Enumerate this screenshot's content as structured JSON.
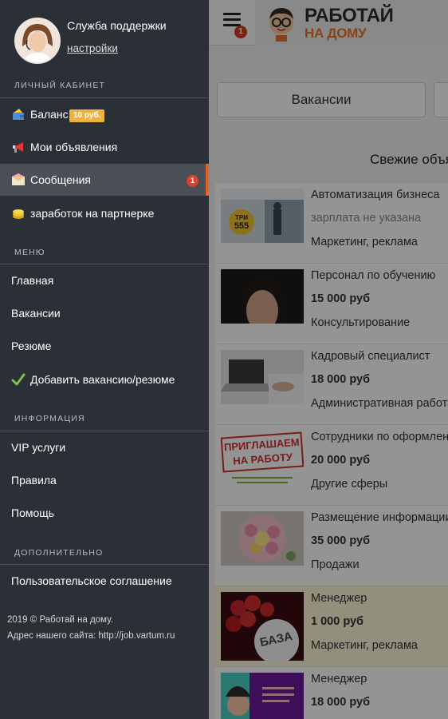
{
  "header": {
    "notification_count": "1",
    "logo_line1": "РАБОТАЙ",
    "logo_line2": "НА ДОМУ"
  },
  "tabs": [
    {
      "label": "Вакансии"
    }
  ],
  "section_title": "Свежие объя",
  "listings": [
    {
      "title": "Автоматизация бизнеса",
      "price": "зарплата не указана",
      "category": "Маркетинг, реклама",
      "thumb_text": [
        "ТРИ",
        "555"
      ],
      "highlight": false
    },
    {
      "title": "Персонал по обучению",
      "price": "15 000 руб",
      "category": "Консультирование",
      "highlight": false
    },
    {
      "title": "Кадровый специалист",
      "price": "18 000 руб",
      "category": "Административная работа",
      "highlight": false
    },
    {
      "title": "Сотрудники по оформлени",
      "price": "20 000 руб",
      "category": "Другие сферы",
      "thumb_text": [
        "ПРИГЛАШАЕМ",
        "НА РАБОТУ"
      ],
      "highlight": false
    },
    {
      "title": "Размещение информации",
      "price": "35 000 руб",
      "category": "Продажи",
      "highlight": false
    },
    {
      "title": "Менеджер",
      "price": "1 000 руб",
      "category": "Маркетинг, реклама",
      "thumb_text": [
        "БАЗА"
      ],
      "highlight": true
    },
    {
      "title": "Менеджер",
      "price": "18 000 руб",
      "category": "",
      "highlight": false
    }
  ],
  "drawer": {
    "profile": {
      "name": "Служба поддержки",
      "settings_link": "настройки"
    },
    "groups": {
      "account": "ЛИЧНЫЙ КАБИНЕТ",
      "menu": "МЕНЮ",
      "info": "ИНФОРМАЦИЯ",
      "extra": "ДОПОЛНИТЕЛЬНО"
    },
    "account_items": [
      {
        "label": "Баланс",
        "icon": "wallet-icon",
        "badge": "10 руб."
      },
      {
        "label": "Мои объявления",
        "icon": "megaphone-icon"
      },
      {
        "label": "Сообщения",
        "icon": "envelope-icon",
        "badge": "1",
        "active": true
      },
      {
        "label": "заработок на партнерке",
        "icon": "coins-icon"
      }
    ],
    "menu_items": [
      {
        "label": "Главная"
      },
      {
        "label": "Вакансии"
      },
      {
        "label": "Резюме"
      },
      {
        "label": "Добавить вакансию/резюме",
        "icon": "checkmark-icon"
      }
    ],
    "info_items": [
      {
        "label": "VIP услуги"
      },
      {
        "label": "Правила"
      },
      {
        "label": "Помощь"
      }
    ],
    "extra_items": [
      {
        "label": "Пользовательское соглашение"
      }
    ],
    "footer": {
      "copyright": "2019 © Работай на дому.",
      "site": "Адрес нашего сайта: http://job.vartum.ru"
    }
  },
  "colors": {
    "drawer_bg": "#2b2f36",
    "accent": "#e5602c",
    "badge_balance": "#f0b23a",
    "badge_notify": "#d8432a",
    "highlight_row": "#fbf8d8"
  }
}
